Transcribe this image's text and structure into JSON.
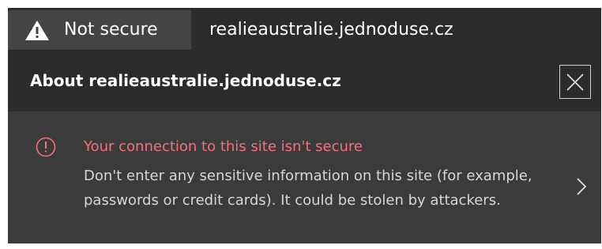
{
  "address_bar": {
    "security_label": "Not secure",
    "security_icon": "warning-triangle-icon",
    "url": "realieaustralie.jednoduse.cz"
  },
  "panel": {
    "title": "About realieaustralie.jednoduse.cz",
    "close_icon": "close-icon",
    "alert": {
      "icon": "info-circle-icon",
      "title": "Your connection to this site isn't secure",
      "description": "Don't enter any sensitive information on this site (for example, passwords or credit cards). It could be stolen by attackers.",
      "chevron_icon": "chevron-right-icon"
    }
  },
  "colors": {
    "bar_bg": "#2b2b2b",
    "chip_bg": "#444444",
    "body_bg": "#3b3b3b",
    "alert_red": "#f1707b"
  }
}
